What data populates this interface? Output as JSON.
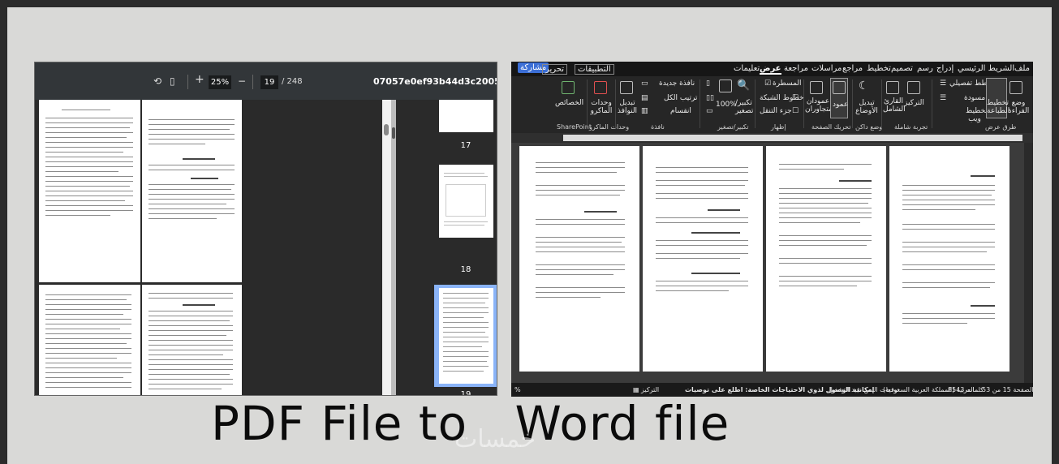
{
  "pdf": {
    "zoom": "25%",
    "page_current": "19",
    "page_total": "/ 248",
    "filename": "07057e0ef93b44d3c2005f9a5abc10ec.p",
    "zoom_in": "+",
    "zoom_out": "−",
    "thumbnails": [
      {
        "label": "17"
      },
      {
        "label": "18"
      },
      {
        "label": "19"
      }
    ]
  },
  "word": {
    "menus": [
      "ملف",
      "الشريط الرئيسي",
      "إدراج",
      "رسم",
      "تصميم",
      "تخطيط",
      "مراجع",
      "مراسلات",
      "مراجعة",
      "عرض",
      "تعليمات"
    ],
    "active_menu": "عرض",
    "apps_label": "التطبيقات",
    "edit_label": "تحرير",
    "share_label": "مشاركة",
    "ribbon": {
      "reading_mode": "وضع القراءة",
      "print_layout": "تخطيط الطباعة",
      "web_layout": "تخطيط ويب",
      "outline": "مخطط تفصيلي",
      "draft": "مسودة",
      "views_group": "طرق عرض",
      "focus": "التركيز",
      "immersive_reader": "القارئ الشامل",
      "immersive_group": "تجربة شاملة",
      "vertical": "عمود",
      "side_by_side": "عمودان متجاوران",
      "page_movement_group": "تحريك الصفحة",
      "switch_modes": "تبديل الأوضاع",
      "dark_mode_group": "وضع داكن",
      "ruler": "المسطرة",
      "gridlines": "خطوط الشبكة",
      "nav_pane": "جزء التنقل",
      "show_group": "إظهار",
      "zoom": "تكبير/تصغير",
      "zoom_100": "100%",
      "zoom_group": "تكبير/تصغير",
      "new_window": "نافذة جديدة",
      "arrange_all": "ترتيب الكل",
      "split": "انقسام",
      "switch_windows": "تبديل النوافذ",
      "window_group": "نافذة",
      "macros": "وحدات الماكرو",
      "macros_group": "وحدات الماكرو",
      "properties": "الخصائص",
      "sharepoint_group": "SharePoint"
    },
    "status": {
      "page": "الصفحة 15 من 53",
      "words": "8543 كلمات",
      "language": "العربية (المملكة العربية السعودية)",
      "predictions": "توقعات النص: قيد التشغيل",
      "accessibility": "إمكانية الوصول لذوي الاحتياجات الخاصة: اطلع على توصيات",
      "focus": "التركيز"
    }
  },
  "caption": {
    "left": "PDF File to",
    "right": "Word file"
  },
  "watermark": "خمسات"
}
